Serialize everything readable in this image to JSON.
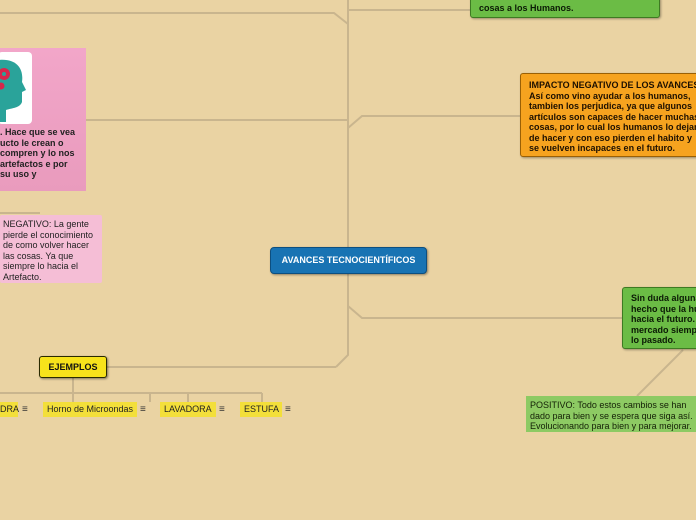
{
  "central": {
    "label": "AVANCES TECNOCIENTÍFICOS"
  },
  "top_green": {
    "text": "cosas a los Humanos."
  },
  "impact_negative": {
    "title": "IMPACTO NEGATIVO DE LOS AVANCES",
    "body": "Así como vino ayudar a los humanos, tambien los perjudica, ya que algunos artículos son capaces de hacer muchas cosas, por lo cual los humanos lo dejan de hacer y con eso pierden el habito y se vuelven incapaces en el futuro."
  },
  "right_green": {
    "text": "Sin duda alguna hecho que la hu hacia el futuro. mercado siemp lo pasado."
  },
  "positive_note": {
    "text": "POSITIVO: Todo estos cambios se han dado para bien y se espera que siga así. Evolucionando para bien y para mejorar."
  },
  "pink_card": {
    "text": ". Hace que se vea ucto le crean o compren y lo nos artefactos e por su uso y",
    "icon": "head-gear-icon"
  },
  "negative_note": {
    "text": "NEGATIVO: La gente pierde el conocimiento de como volver hacer las cosas. Ya que siempre lo hacia el Artefacto."
  },
  "examples": {
    "label": "EJEMPLOS",
    "items": [
      {
        "label": "DRA",
        "icon": "menu-icon"
      },
      {
        "label": "Horno de Microondas",
        "icon": "menu-icon"
      },
      {
        "label": "LAVADORA",
        "icon": "menu-icon"
      },
      {
        "label": "ESTUFA",
        "icon": "menu-icon"
      }
    ]
  },
  "colors": {
    "background": "#ead3a3",
    "central": "#1873b3",
    "green": "#6bbc45",
    "orange": "#f6a31f",
    "pink": "#f2a6c9",
    "yellow": "#f7e21b"
  }
}
